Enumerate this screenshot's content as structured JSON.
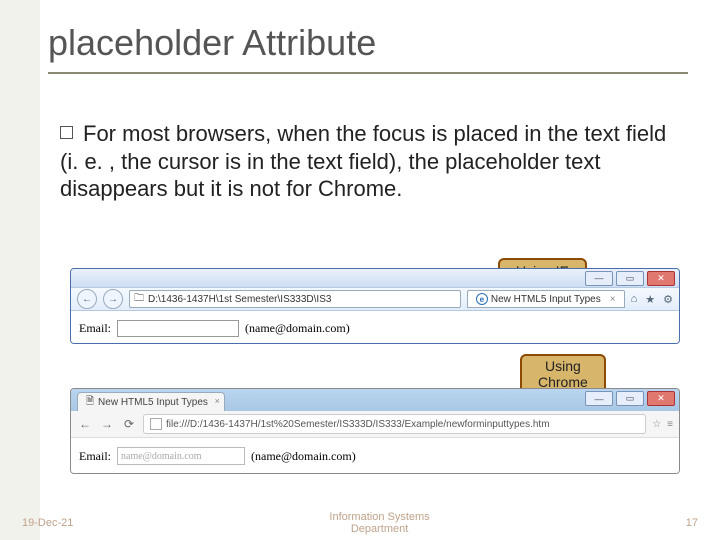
{
  "title": "placeholder Attribute",
  "bullet": "For most browsers, when the focus is placed in the text field (i. e. , the cursor is in the text field), the placeholder text disappears but it is not for Chrome.",
  "callouts": {
    "ie": "Using IE",
    "chrome": "Using\nChrome"
  },
  "ie": {
    "url": "D:\\1436-1437H\\1st Semester\\IS333D\\IS3",
    "tab": "New HTML5 Input Types",
    "label": "Email:",
    "hint": "(name@domain.com)"
  },
  "chrome": {
    "tab": "New HTML5 Input Types",
    "url": "file:///D:/1436-1437H/1st%20Semester/IS333D/IS333/Example/newforminputtypes.htm",
    "label": "Email:",
    "placeholder": "name@domain.com",
    "hint": "(name@domain.com)"
  },
  "footer": {
    "date": "19-Dec-21",
    "dept1": "Information Systems",
    "dept2": "Department",
    "page": "17"
  }
}
